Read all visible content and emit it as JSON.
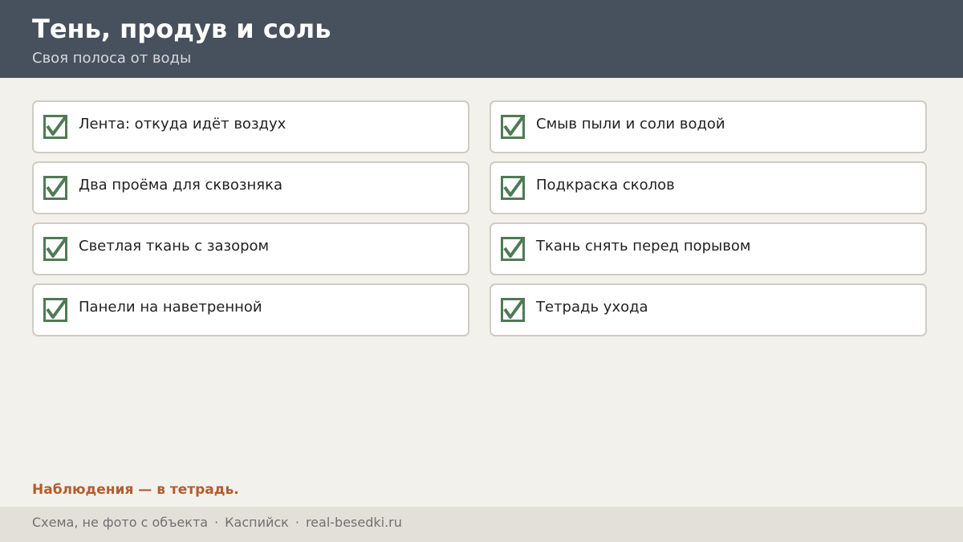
{
  "header": {
    "title": "Тень, продув и соль",
    "subtitle": "Своя полоса от воды"
  },
  "checklist": {
    "left": [
      {
        "label": "Лента: откуда идёт воздух",
        "checked": true
      },
      {
        "label": "Два проёма для сквозняка",
        "checked": true
      },
      {
        "label": "Светлая ткань с зазором",
        "checked": true
      },
      {
        "label": "Панели на наветренной",
        "checked": true
      }
    ],
    "right": [
      {
        "label": "Смыв пыли и соли водой",
        "checked": true
      },
      {
        "label": "Подкраска сколов",
        "checked": true
      },
      {
        "label": "Ткань снять перед порывом",
        "checked": true
      },
      {
        "label": "Тетрадь ухода",
        "checked": true
      }
    ]
  },
  "note": "Наблюдения — в тетрадь.",
  "footer": {
    "disclaimer": "Схема, не фото с объекта",
    "separator": "·",
    "city": "Каспийск",
    "site": "real-besedki.ru"
  },
  "colors": {
    "header_bg": "#47515e",
    "check_green": "#4f7a55",
    "note_accent": "#b55c2c"
  },
  "icons": {
    "checkbox": "checked-checkbox-icon"
  }
}
